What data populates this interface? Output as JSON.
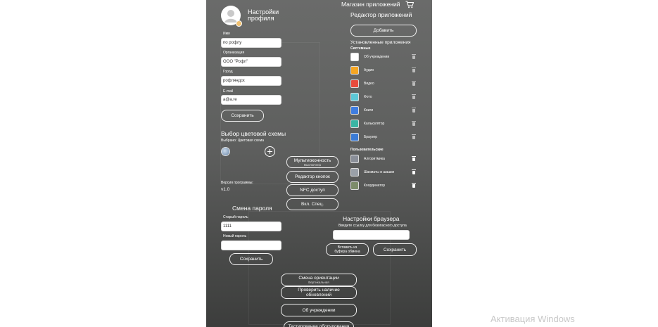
{
  "profile": {
    "title_line1": "Настройки",
    "title_line2": "профиля",
    "name_label": "Имя",
    "name_value": "по рофлу",
    "org_label": "Организация",
    "org_value": "ООО \"Рофл\"",
    "city_label": "Город",
    "city_value": "рофляндск",
    "email_label": "E-mail",
    "email_value": "a@a.re",
    "save_label": "Сохранить"
  },
  "color_scheme": {
    "title": "Выбор цветовой схемы",
    "selected": "Выбрано: Цветовая схема"
  },
  "version": {
    "label": "Версия программы:",
    "value": "v1.0"
  },
  "middle_buttons": {
    "multiwindow_label": "Мультиоконность",
    "multiwindow_sub": "Выключена",
    "button_editor": "Редактор кнопок",
    "nfc": "NFC доступ",
    "special": "Вкл. Спец."
  },
  "password": {
    "title": "Смена пароля",
    "old_label": "Старый пароль",
    "old_value": "1111",
    "new_label": "Новый пароль",
    "new_value": "",
    "save_label": "Сохранить"
  },
  "store": {
    "title": "Магазин приложений",
    "editor_title": "Редактор приложений",
    "add_label": "Добавить",
    "installed_title": "Установленные приложения",
    "system_label": "Системные",
    "user_label": "Пользовательские",
    "system_apps": [
      {
        "name": "Об учреждении",
        "icon": "info-icon",
        "color": "#ffffff"
      },
      {
        "name": "Аудио",
        "icon": "audio-icon",
        "color": "#f5a623"
      },
      {
        "name": "Видео",
        "icon": "video-icon",
        "color": "#e84a3c"
      },
      {
        "name": "Фото",
        "icon": "photo-icon",
        "color": "#5cc8d6"
      },
      {
        "name": "Книги",
        "icon": "books-icon",
        "color": "#3f7de0"
      },
      {
        "name": "Калькулятор",
        "icon": "calculator-icon",
        "color": "#39b5a4"
      },
      {
        "name": "Браузер",
        "icon": "browser-icon",
        "color": "#3a7bd5"
      }
    ],
    "user_apps": [
      {
        "name": "Алгоритмика",
        "icon": "algorithmics-icon",
        "color": "#8a8f99"
      },
      {
        "name": "Шахматы и шашки",
        "icon": "chess-icon",
        "color": "#9aa0a8"
      },
      {
        "name": "Координатор",
        "icon": "coordinator-icon",
        "color": "#7d8c6a"
      }
    ]
  },
  "browser": {
    "title": "Настройки браузера",
    "hint": "Введите ссылку для безопасного доступа",
    "url_value": "",
    "paste_label_1": "Вставить из",
    "paste_label_2": "буфера обмена",
    "save_label": "Сохранить"
  },
  "bottom_buttons": {
    "orientation_label": "Смена ориентации",
    "orientation_sub": "Вертикальная",
    "update_label_1": "Проверить наличие",
    "update_label_2": "обновлений",
    "about_label": "Об учреждении",
    "last_label": "Тестирование оборудования"
  },
  "watermark": "Активация Windows",
  "colors": {
    "panel_top": "#6a6b6a",
    "panel_bottom": "#3c3d3c"
  }
}
